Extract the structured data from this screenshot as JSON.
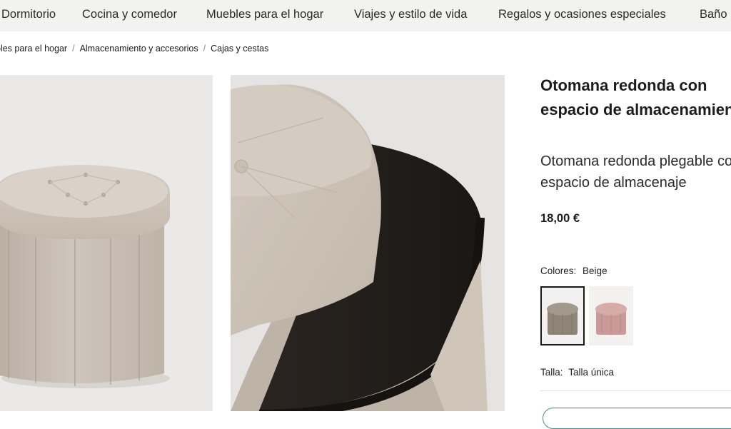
{
  "nav": {
    "items": [
      "Dormitorio",
      "Cocina y comedor",
      "Muebles para el hogar",
      "Viajes y estilo de vida",
      "Regalos y ocasiones especiales",
      "Baño"
    ]
  },
  "breadcrumb": {
    "items": [
      "bles para el hogar",
      "Almacenamiento y accesorios",
      "Cajas y cestas"
    ],
    "separator": "/"
  },
  "product": {
    "title": "Otomana redonda con espacio de almacenamiento",
    "subtitle": "Otomana redonda plegable con espacio de almacenaje",
    "price": "18,00 €",
    "colors_label": "Colores:",
    "selected_color": "Beige",
    "swatches": [
      {
        "color_name": "Beige",
        "hex": "#8e8478",
        "selected": true
      },
      {
        "color_name": "Rosa",
        "hex": "#c99a98",
        "selected": false
      }
    ],
    "size_label": "Talla:",
    "size_value": "Talla única"
  },
  "colors": {
    "nav_bg": "#f2f2f0",
    "accent_outline": "#4a8a82"
  }
}
